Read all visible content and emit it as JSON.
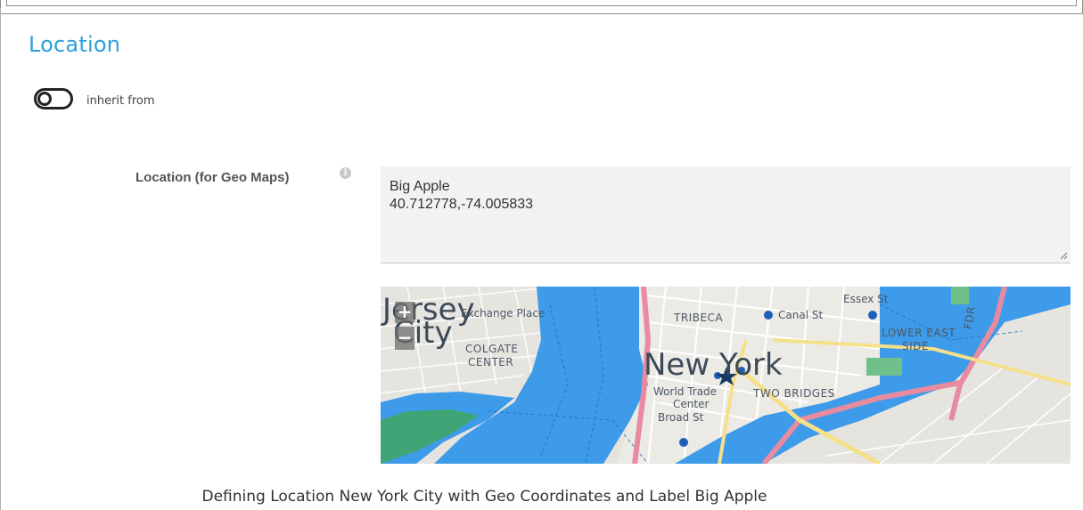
{
  "section": {
    "title": "Location"
  },
  "inherit": {
    "label": "inherit from",
    "state": "off"
  },
  "field": {
    "label": "Location (for Geo Maps)",
    "info_icon": "info-icon",
    "value_lines": [
      "Big Apple",
      "40.712778,-74.005833"
    ]
  },
  "map": {
    "zoom_in": "+",
    "zoom_out": "−",
    "labels": {
      "jersey": "Jersey",
      "city": "City",
      "exchange_place": "Exchange Place",
      "colgate": "COLGATE",
      "center": "CENTER",
      "tribeca": "TRIBECA",
      "canal_st": "Canal St",
      "essex_st": "Essex St",
      "lower_east": "LOWER EAST",
      "side": "SIDE",
      "fdr": "FDR",
      "new_york": "New York",
      "world_trade": "World Trade",
      "wt_center": "Center",
      "broad_st": "Broad St",
      "two_bridges": "TWO BRIDGES"
    },
    "colors": {
      "water": "#3d9be9",
      "land": "#e6e4df",
      "park": "#3fa66a",
      "highway": "#e88aa0",
      "major_road": "#f5e08a"
    }
  },
  "caption": "Defining Location New York City with Geo Coordinates and Label Big Apple"
}
